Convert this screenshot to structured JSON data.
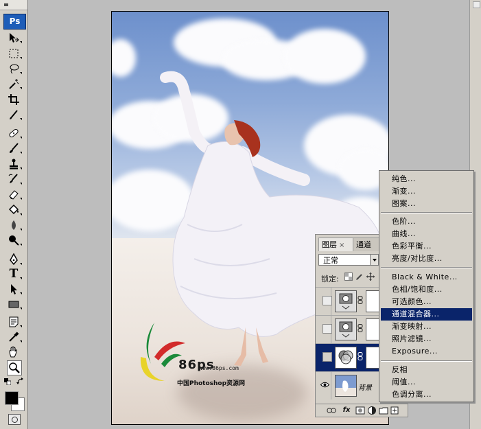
{
  "app": {
    "logo": "Ps"
  },
  "tools": [
    {
      "id": "move",
      "icon": "move-icon"
    },
    {
      "id": "marquee",
      "icon": "rect-marquee-icon"
    },
    {
      "id": "lasso",
      "icon": "lasso-icon"
    },
    {
      "id": "magic",
      "icon": "magic-wand-icon"
    },
    {
      "id": "crop",
      "icon": "crop-icon"
    },
    {
      "id": "eyedropper-slice",
      "icon": "slice-icon"
    },
    {
      "id": "heal",
      "icon": "healing-brush-icon"
    },
    {
      "id": "brush",
      "icon": "brush-icon"
    },
    {
      "id": "stamp",
      "icon": "clone-stamp-icon"
    },
    {
      "id": "history",
      "icon": "history-brush-icon"
    },
    {
      "id": "eraser",
      "icon": "eraser-icon"
    },
    {
      "id": "bucket",
      "icon": "paint-bucket-icon"
    },
    {
      "id": "blur",
      "icon": "blur-icon"
    },
    {
      "id": "dodge",
      "icon": "dodge-icon"
    },
    {
      "id": "pen",
      "icon": "pen-icon"
    },
    {
      "id": "type",
      "icon": "type-icon",
      "glyph": "T"
    },
    {
      "id": "select",
      "icon": "path-select-icon"
    },
    {
      "id": "shape",
      "icon": "rectangle-shape-icon"
    },
    {
      "id": "notes",
      "icon": "notes-icon"
    },
    {
      "id": "eyedrop",
      "icon": "eyedropper-icon"
    },
    {
      "id": "hand",
      "icon": "hand-icon"
    },
    {
      "id": "zoom",
      "icon": "zoom-icon"
    }
  ],
  "colors": {
    "foreground": "#000000",
    "background": "#ffffff",
    "selection": "#0a246a"
  },
  "watermark": {
    "number": "86ps",
    "url": "www.86ps.com",
    "cn_name": "中国Photoshop资源网"
  },
  "layers_panel": {
    "tabs": [
      {
        "label": "图层",
        "close": "×"
      },
      {
        "label": "通道"
      }
    ],
    "blend_mode": "正常",
    "lock_label": "锁定:",
    "layers": [
      {
        "kind": "adjustment"
      },
      {
        "kind": "adjustment"
      },
      {
        "kind": "adjustment",
        "selected": true
      },
      {
        "kind": "background",
        "name": "背景",
        "visible": true
      }
    ],
    "footer": [
      "link-icon",
      "fx-icon",
      "mask-icon",
      "adjustment-icon",
      "group-icon",
      "new-layer-icon",
      "trash-icon"
    ],
    "footer_fx": "fx"
  },
  "context_menu": {
    "groups": [
      [
        "纯色...",
        "渐变...",
        "图案..."
      ],
      [
        "色阶...",
        "曲线...",
        "色彩平衡...",
        "亮度/对比度..."
      ],
      [
        "Black & White...",
        "色相/饱和度...",
        "可选颜色...",
        "通道混合器...",
        "渐变映射...",
        "照片滤镜...",
        "Exposure..."
      ],
      [
        "反相",
        "阈值...",
        "色调分离..."
      ]
    ],
    "selected": "通道混合器..."
  }
}
